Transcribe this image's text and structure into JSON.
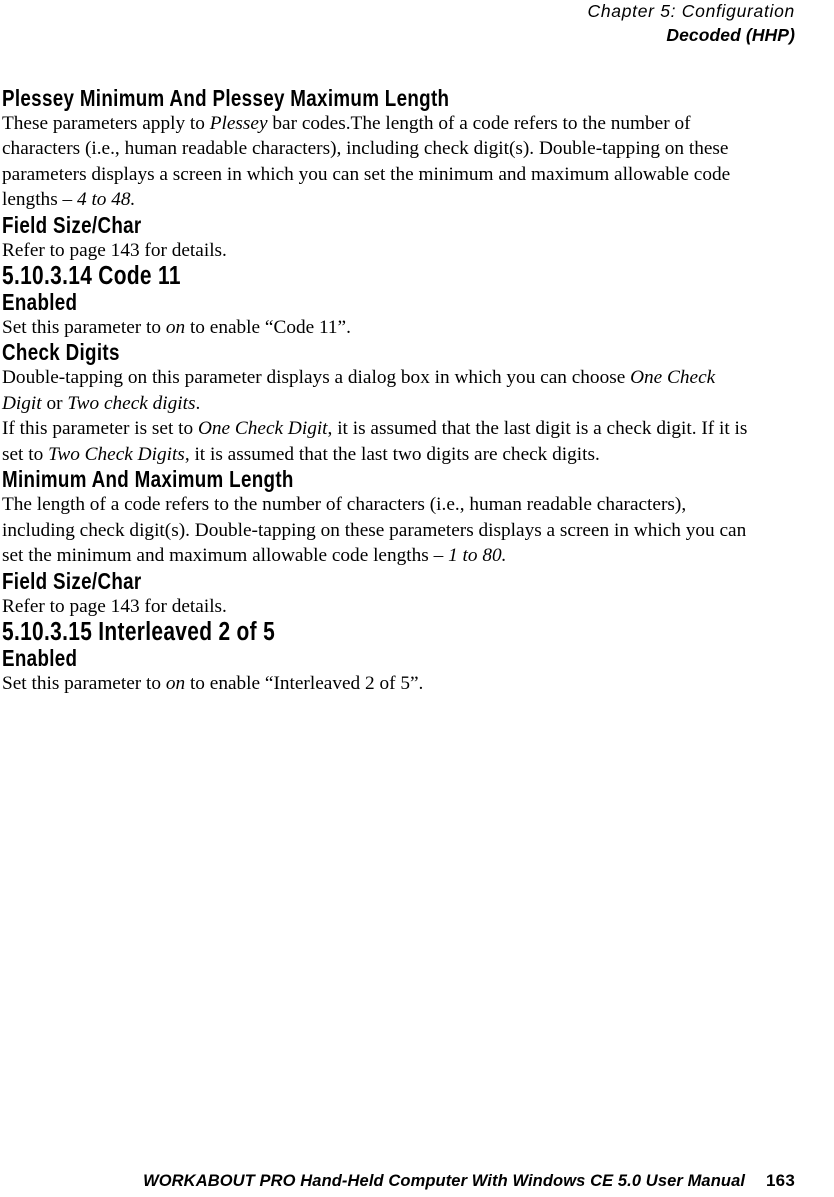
{
  "header": {
    "chapter": "Chapter 5:  Configuration",
    "subject": "Decoded (HHP)"
  },
  "footer": {
    "text": "WORKABOUT PRO Hand-Held Computer With Windows CE 5.0 User Manual",
    "page_number": "163"
  },
  "sections": {
    "plessey_length_heading": "Plessey Minimum And Plessey Maximum Length",
    "plessey_length_body_1": "These parameters apply to ",
    "plessey_length_body_em1": "Plessey",
    "plessey_length_body_2": " bar codes.The length of a code refers to the number of characters (i.e., human readable characters), including check digit(s). Double-tapping on these parameters displays a screen in which you can set the minimum and maximum allowable code lengths – ",
    "plessey_length_body_em2": "4 to 48.",
    "field_size_char_heading_1": "Field Size/Char",
    "field_size_char_body_1": "Refer to page 143 for details.",
    "code11_number_heading": "5.10.3.14  Code 11",
    "code11_enabled_heading": "Enabled",
    "code11_enabled_body_1": "Set this parameter to ",
    "code11_enabled_body_em": "on",
    "code11_enabled_body_2": " to enable “Code 11”.",
    "check_digits_heading": "Check Digits",
    "check_digits_body_1": "Double-tapping on this parameter displays a dialog box in which you can choose ",
    "check_digits_body_em1": "One Check Digit",
    "check_digits_body_2": " or ",
    "check_digits_body_em2": "Two check digits",
    "check_digits_body_3": ".",
    "check_digits_body2_1": "If this parameter is set to ",
    "check_digits_body2_em1": "One Check Digit",
    "check_digits_body2_2": ", it is assumed that the last digit is a check digit. If it is set to ",
    "check_digits_body2_em2": "Two Check Digits",
    "check_digits_body2_3": ", it is assumed that the last two digits are check digits.",
    "min_max_length_heading": "Minimum And Maximum Length",
    "min_max_length_body_1": "The length of a code refers to the number of characters (i.e., human readable characters), including check digit(s). Double-tapping on these parameters displays a screen in which you can set the minimum and maximum allowable code lengths – ",
    "min_max_length_body_em": "1 to 80.",
    "field_size_char_heading_2": "Field Size/Char",
    "field_size_char_body_2": "Refer to page 143 for details.",
    "i2of5_number_heading": "5.10.3.15  Interleaved 2 of 5",
    "i2of5_enabled_heading": "Enabled",
    "i2of5_enabled_body_1": "Set this parameter to ",
    "i2of5_enabled_body_em": "on",
    "i2of5_enabled_body_2": " to enable “Interleaved 2 of 5”."
  }
}
